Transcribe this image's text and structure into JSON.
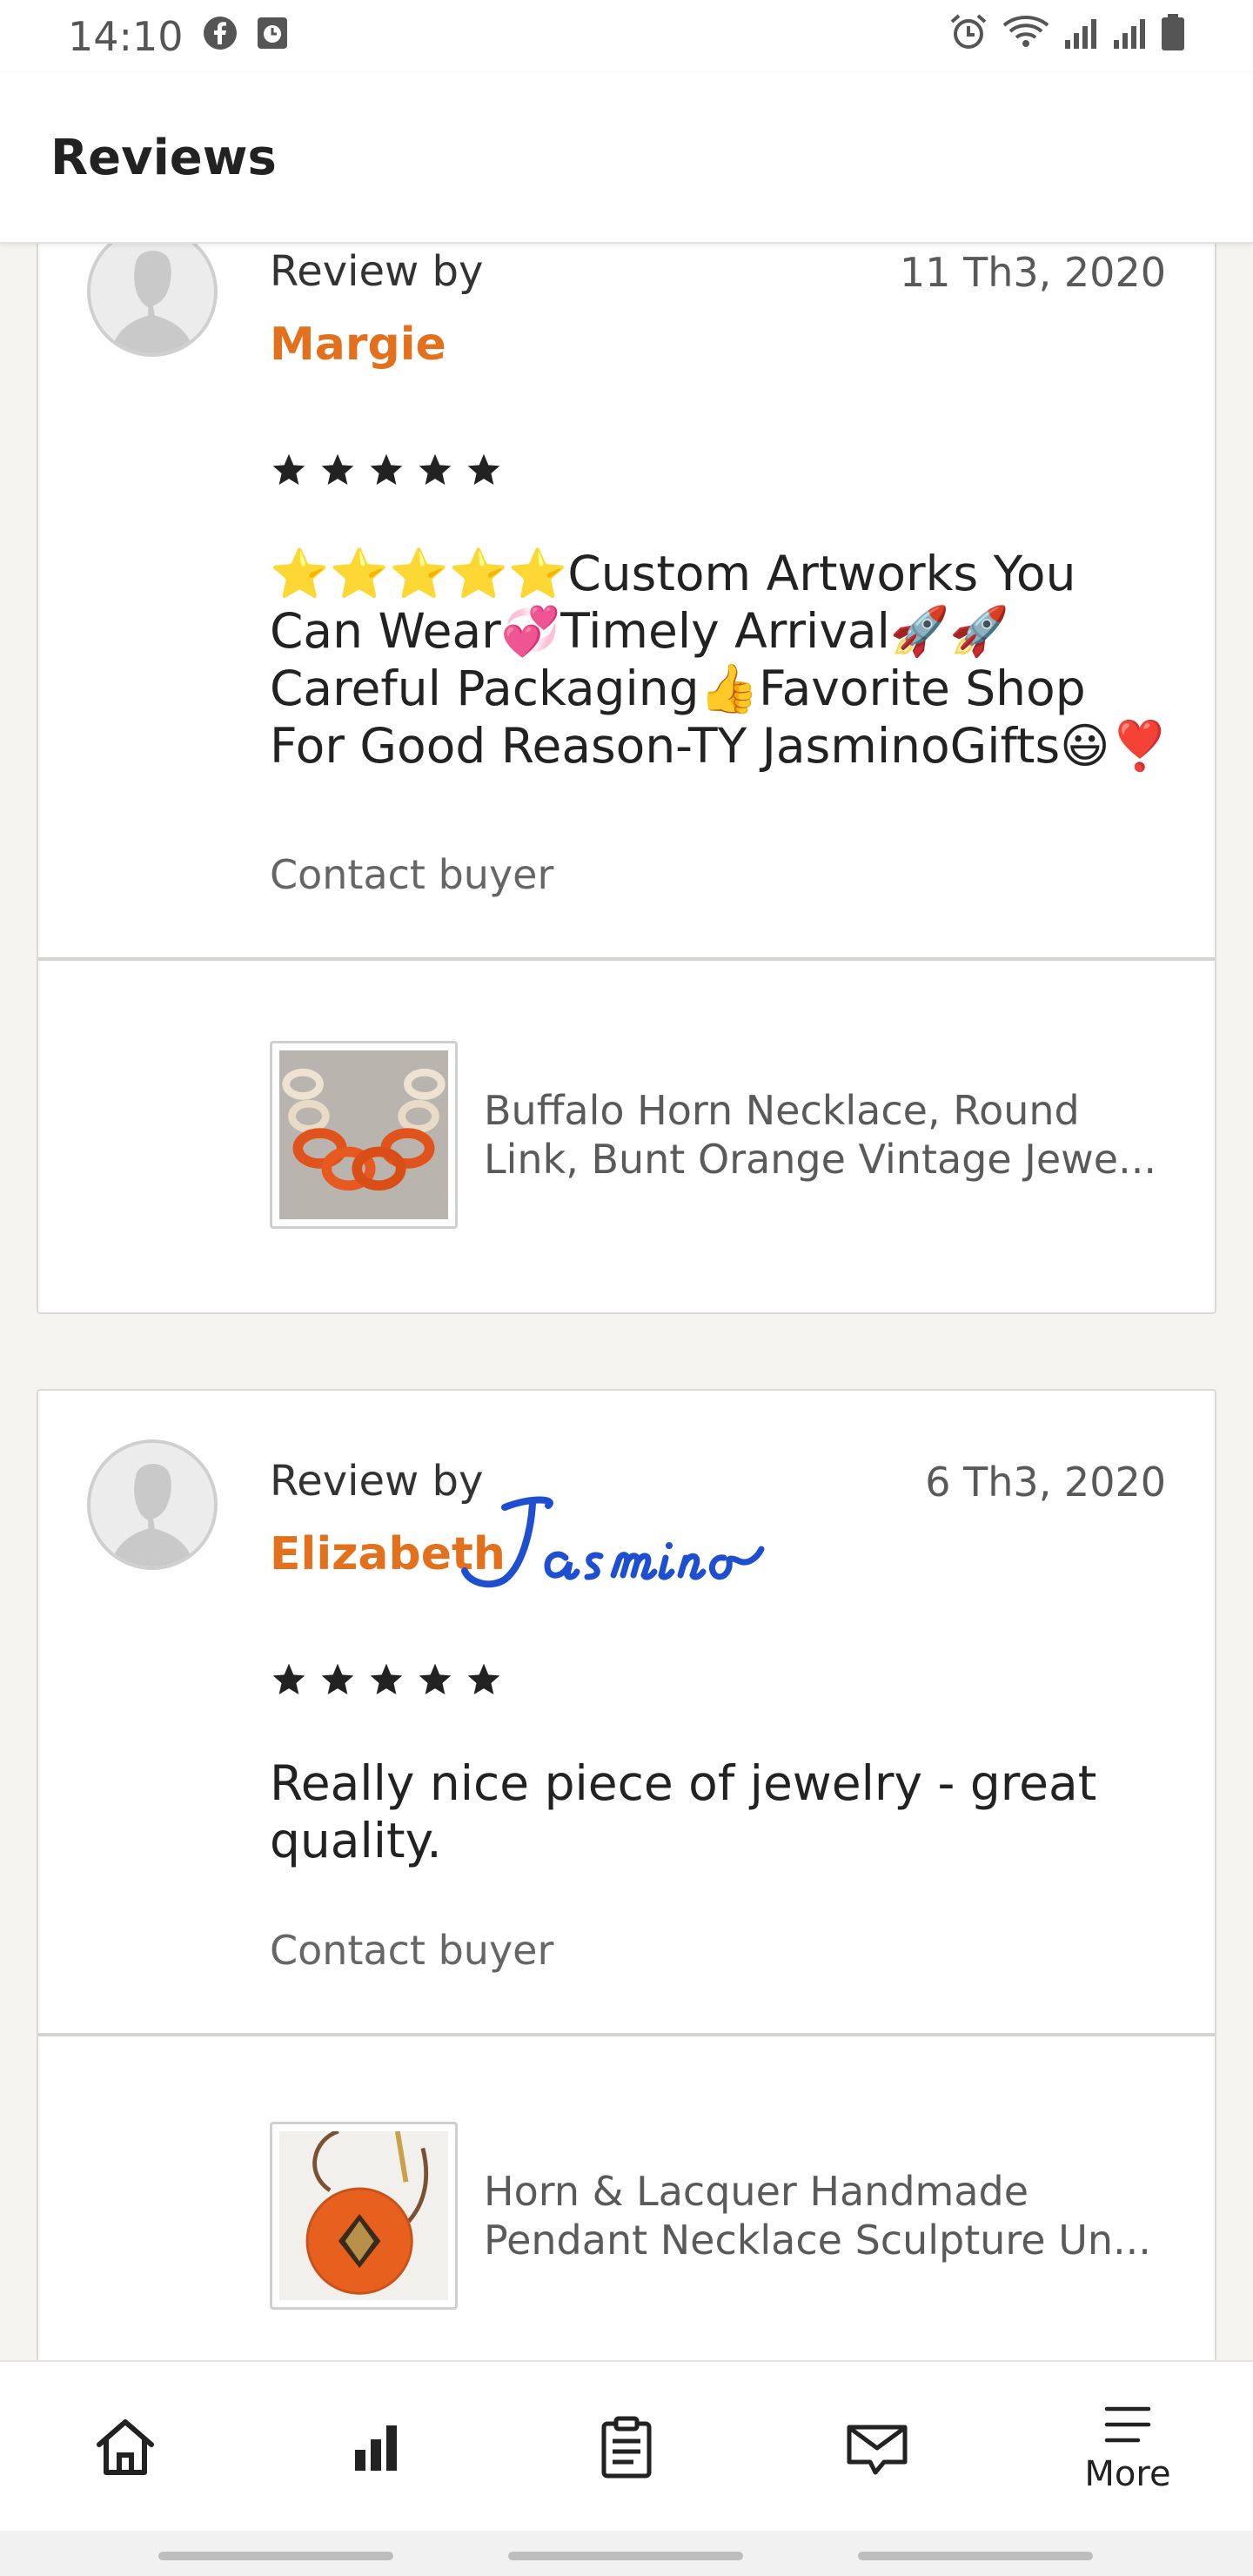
{
  "status_bar": {
    "time": "14:10",
    "left_icons": [
      "facebook-icon",
      "clock-app-icon"
    ],
    "right_icons": [
      "alarm-icon",
      "wifi-icon",
      "signal-icon",
      "signal-icon",
      "battery-icon"
    ]
  },
  "header": {
    "title": "Reviews"
  },
  "reviews": [
    {
      "review_by_label": "Review by",
      "reviewer": "Margie",
      "date": "11 Th3, 2020",
      "rating": 5,
      "text": "⭐⭐⭐⭐⭐Custom Artworks You Can Wear💞Timely Arrival🚀🚀Careful Packaging👍Favorite Shop For Good Reason-TY JasminoGifts😃❣️",
      "contact_label": "Contact buyer",
      "listing_title": "Buffalo Horn Necklace, Round Link, Bunt Orange Vintage Jewe..."
    },
    {
      "review_by_label": "Review by",
      "reviewer": "Elizabeth",
      "date": "6 Th3, 2020",
      "rating": 5,
      "text": "Really nice piece of jewelry - great quality.",
      "contact_label": "Contact buyer",
      "listing_title": "Horn & Lacquer Handmade Pendant Necklace Sculpture Un..."
    }
  ],
  "watermark": {
    "text": "Jasmino"
  },
  "bottom_nav": {
    "items": [
      {
        "icon": "home-icon",
        "label": ""
      },
      {
        "icon": "stats-icon",
        "label": ""
      },
      {
        "icon": "orders-icon",
        "label": ""
      },
      {
        "icon": "messages-icon",
        "label": ""
      },
      {
        "icon": "menu-icon",
        "label": "More"
      }
    ]
  },
  "colors": {
    "accent": "#e2701d",
    "background": "#f5f4f1",
    "card": "#ffffff",
    "watermark": "#1f4fd1"
  }
}
